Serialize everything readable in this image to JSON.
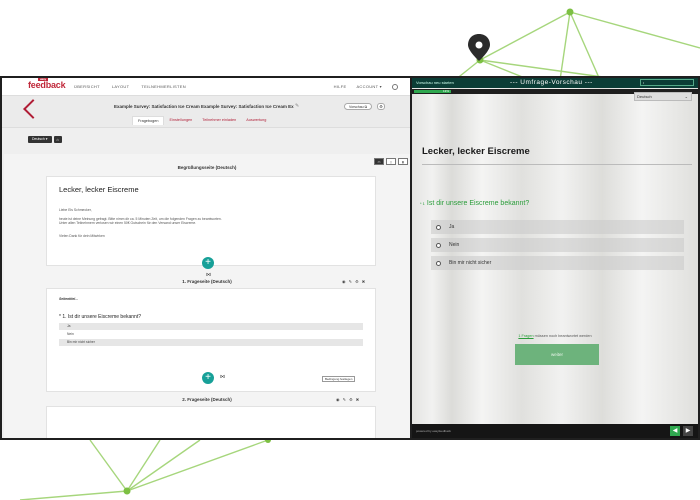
{
  "nav": {
    "logo": "feedback",
    "logo_badge": "easy",
    "links": [
      "ÜBERSICHT",
      "LAYOUT",
      "TEILNEHMERLISTEN"
    ],
    "help": "HILFE",
    "account": "ACCOUNT ▾"
  },
  "survey": {
    "title": "Example Survey: Satisfaction Ice Cream Example Survey: Satisfaction Ice Cream Ex",
    "preview_label": "Vorschau ⧉",
    "tabs": [
      "Fragebogen",
      "Einstellungen",
      "Teilnehmer einladen",
      "Auswertung"
    ]
  },
  "editor": {
    "language_button": "Deutsch ▾",
    "welcome_title": "Begrüßungsseite (Deutsch)",
    "welcome_heading": "Lecker, lecker Eiscreme",
    "welcome_text": {
      "greeting": "Liebe Eis Schmecker,",
      "line1": "heute ist deine Meinung gefragt. Bitte nimm dir ca. 5 Minuten Zeit, um die folgenden Fragen zu beantworten.",
      "line2": "Unter allen Teilnehmern verlosen wir einen 50€ Gutschein für den Versand unser Eiscreme.",
      "thanks": "Vielen Dank für dein Mitwirken"
    },
    "page1_title": "1. Frageseite (Deutsch)",
    "page_subtitle": "Seitentitel...",
    "question": "* 1. Ist dir unsere Eiscreme bekannt?",
    "options": [
      "Ja",
      "Nein",
      "Bin mir nicht sicher"
    ],
    "add_question_label": "Bedingung festlegen",
    "page2_title": "2. Frageseite (Deutsch)"
  },
  "preview": {
    "reset_label": "Vorschau neu starten",
    "window_title": "--- Umfrage-Vorschau ---",
    "progress_label": "13%",
    "progress_fraction": 0.13,
    "language": "Deutsch",
    "heading": "Lecker, lecker Eiscreme",
    "question_number": "* 1",
    "question": "Ist dir unsere Eiscreme bekannt?",
    "options": [
      "Ja",
      "Nein",
      "Bin mir nicht sicher"
    ],
    "notice_link": "1 Fragen",
    "notice_text": " müssen noch beantwortet werden",
    "next_button": "weiter",
    "powered_by": "powered by easyfeedback",
    "prev_arrow": "◀",
    "next_arrow": "▶"
  },
  "colors": {
    "brand": "#c0283a",
    "teal": "#17a098",
    "preview_header": "#0b3d36",
    "accent_green": "#2a9d3a",
    "network_line": "#a6d67c",
    "network_node": "#7dc043"
  },
  "icons": [
    "location-pin-icon",
    "home-icon",
    "gear-icon",
    "plus-icon",
    "desktop-icon",
    "tablet-icon",
    "phone-icon",
    "edit-icon",
    "globe-icon"
  ]
}
